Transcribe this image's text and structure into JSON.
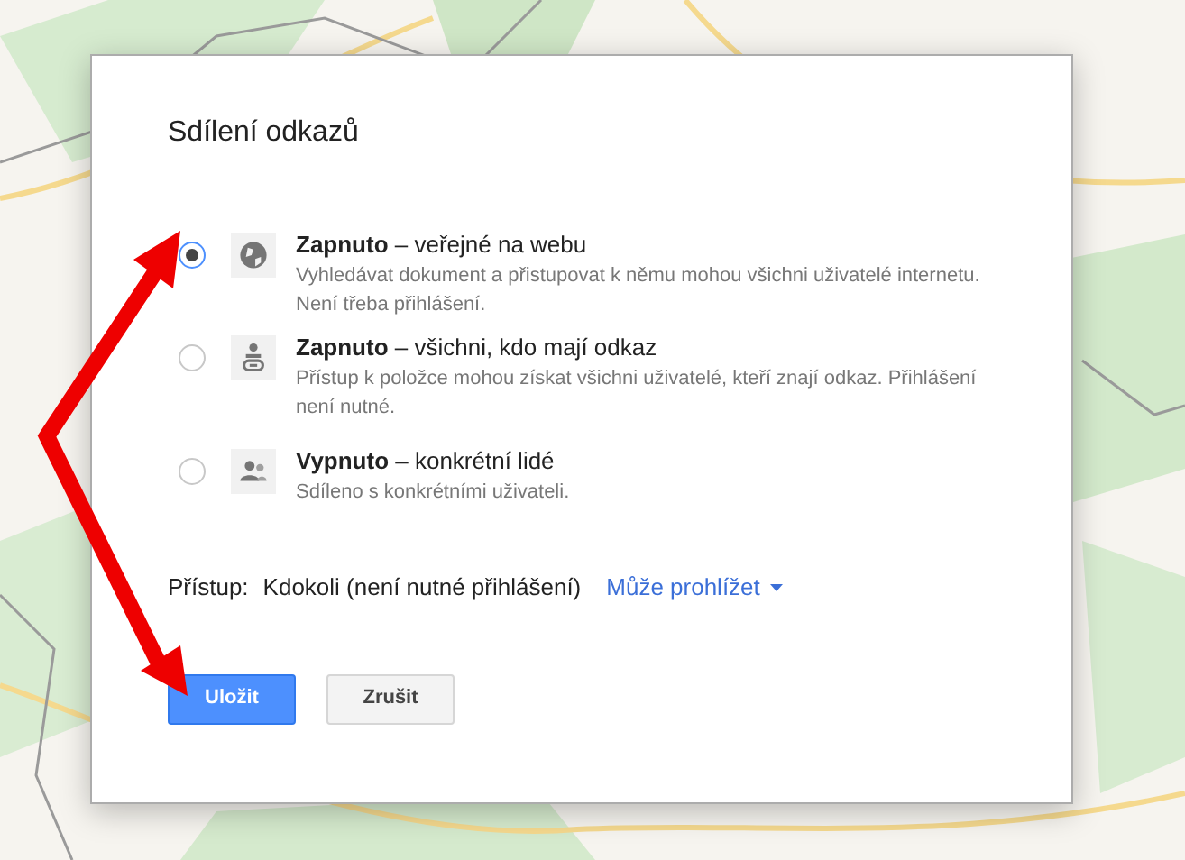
{
  "dialog": {
    "title": "Sdílení odkazů",
    "options": [
      {
        "kind": "globe",
        "title": "**Zapnuto** – veřejné na webu",
        "description": "Vyhledávat dokument a přistupovat k němu mohou všichni uživatelé internetu. Není třeba přihlášení.",
        "selected": true
      },
      {
        "kind": "link",
        "title": "**Zapnuto** – všichni, kdo mají odkaz",
        "description": "Přístup k položce mohou získat všichni uživatelé, kteří znají odkaz. Přihlášení není nutné.",
        "selected": false
      },
      {
        "kind": "people",
        "title": "**Vypnuto** – konkrétní lidé",
        "description": "Sdíleno s konkrétními uživateli.",
        "selected": false
      }
    ],
    "access": {
      "label": "Přístup:",
      "value": "Kdokoli (není nutné přihlášení)",
      "permission": "Může prohlížet"
    },
    "buttons": [
      {
        "label": "Uložit",
        "kind": "primary"
      },
      {
        "label": "Zrušit",
        "kind": "secondary"
      }
    ]
  }
}
